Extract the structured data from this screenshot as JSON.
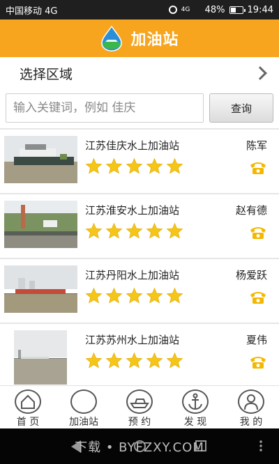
{
  "status_bar": {
    "carrier": "中国移动 4G",
    "network": "4G",
    "battery": "48%",
    "battery_level": 0.48,
    "time": "19:44"
  },
  "header": {
    "title": "加油站",
    "logo_icon": "water-drop-icon"
  },
  "region": {
    "label": "选择区域"
  },
  "search": {
    "placeholder": "输入关键词，例如 佳庆",
    "value": "",
    "button_label": "查询"
  },
  "stations": [
    {
      "name": "江苏佳庆水上加油站",
      "contact": "陈军",
      "rating": 5
    },
    {
      "name": "江苏淮安水上加油站",
      "contact": "赵有德",
      "rating": 5
    },
    {
      "name": "江苏丹阳水上加油站",
      "contact": "杨爱跃",
      "rating": 5
    },
    {
      "name": "江苏苏州水上加油站",
      "contact": "夏伟",
      "rating": 5
    }
  ],
  "bottom_nav": {
    "items": [
      {
        "label": "首 页",
        "icon": "home-icon",
        "active": false
      },
      {
        "label": "加油站",
        "icon": "drop-icon",
        "active": true
      },
      {
        "label": "预 约",
        "icon": "ship-icon",
        "active": false
      },
      {
        "label": "发 现",
        "icon": "anchor-icon",
        "active": false
      },
      {
        "label": "我 的",
        "icon": "user-icon",
        "active": false
      }
    ]
  },
  "watermark": "下载 • BYFZXY.COM",
  "colors": {
    "header_bg": "#f7a51e",
    "star": "#f5c518",
    "active_nav": "#29c14a"
  }
}
